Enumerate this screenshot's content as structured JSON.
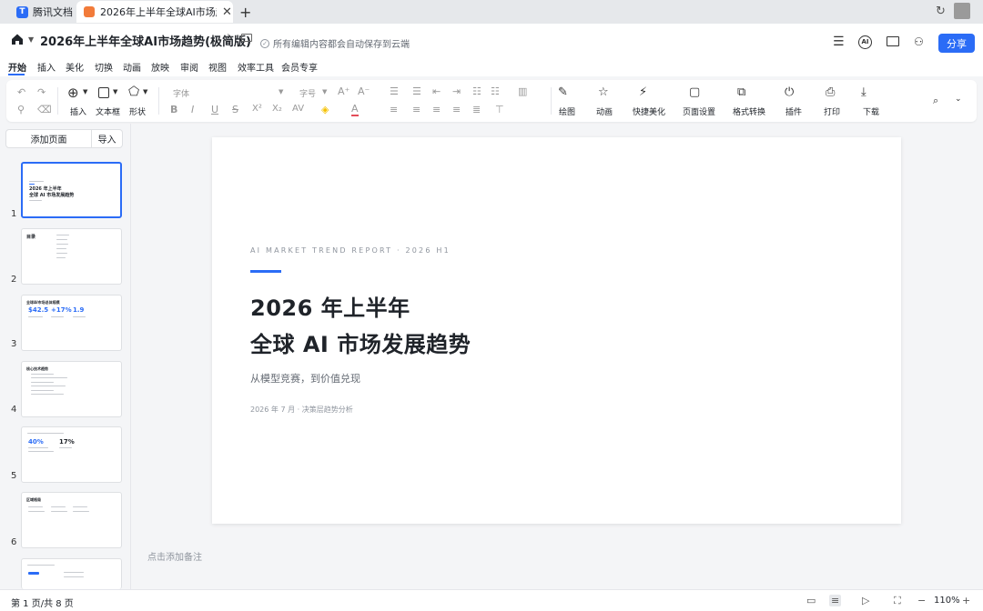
{
  "tabs": {
    "home_label": "腾讯文档",
    "active_label": "2026年上半年全球AI市场趋势(极简版)"
  },
  "header": {
    "title": "2026年上半年全球AI市场趋势(极简版)",
    "save_status": "所有编辑内容都会自动保存到云端",
    "share_label": "分享",
    "ai_label": "AI"
  },
  "menu": [
    "开始",
    "插入",
    "美化",
    "切换",
    "动画",
    "放映",
    "审阅",
    "视图",
    "效率工具",
    "会员专享"
  ],
  "toolbar": {
    "insert": "插入",
    "textbox": "文本框",
    "shape": "形状",
    "font_placeholder": "字体",
    "size_placeholder": "字号",
    "draw": "绘图",
    "animation": "动画",
    "quick_beautify": "快捷美化",
    "page_setup": "页面设置",
    "format_convert": "格式转换",
    "plugin": "插件",
    "print": "打印",
    "download": "下载"
  },
  "sidebar": {
    "add_page": "添加页面",
    "import": "导入",
    "slides": [
      "1",
      "2",
      "3",
      "4",
      "5",
      "6"
    ],
    "thumb1_line1": "2026 年上半年",
    "thumb1_line2": "全球 AI 市场发展趋势",
    "thumb2_title": "目录",
    "thumb3_title": "全球AI市场总体规模",
    "thumb3_v1": "$42.5",
    "thumb3_v2": "+17%",
    "thumb3_v3": "1.9",
    "thumb4_title": "核心技术趋势",
    "thumb5_v1": "40%",
    "thumb5_v2": "17%",
    "thumb6_title": "区域格局"
  },
  "slide": {
    "eyebrow": "AI MARKET TREND REPORT · 2026 H1",
    "title_line1": "2026 年上半年",
    "title_line2": "全球 AI 市场发展趋势",
    "subtitle": "从模型竞赛，到价值兑现",
    "meta": "2026 年 7 月 · 决策层趋势分析"
  },
  "notes_placeholder": "点击添加备注",
  "status": {
    "page_info": "第 1 页/共 8 页",
    "zoom": "110%"
  },
  "colors": {
    "accent": "#2b6cf6",
    "ppt_orange": "#f27b3a"
  }
}
